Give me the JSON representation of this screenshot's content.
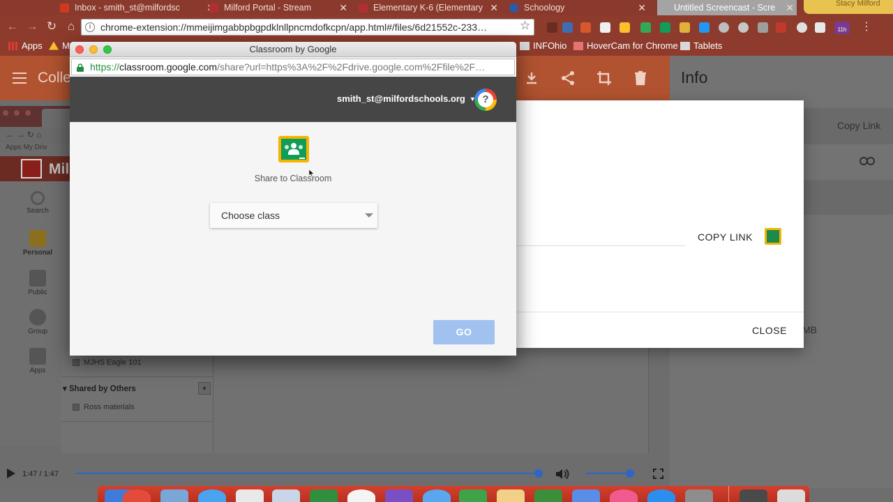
{
  "chrome": {
    "tabs": [
      {
        "label": "Inbox - smith_st@milfordsc",
        "color": "#d0391d"
      },
      {
        "label": "Milford Portal - Stream",
        "color": "#b03030"
      },
      {
        "label": "Elementary K-6 (Elementary",
        "color": "#b03030"
      },
      {
        "label": "Schoology",
        "color": "#2a5aa8"
      },
      {
        "label": "Untitled Screencast - Scre",
        "color": "#9a9a9a"
      }
    ],
    "profile": "Stacy Milford",
    "url": "chrome-extension://mmeijimgabbpbgpdklnllpncmdofkcpn/app.html#/files/6d21552c-233…",
    "bookmarks": [
      {
        "label": "Apps"
      },
      {
        "label": "M"
      },
      {
        "label": "INFOhio"
      },
      {
        "label": "HoverCam for Chrome"
      },
      {
        "label": "Tablets"
      }
    ],
    "extension_badge": "11h"
  },
  "app": {
    "title": "Colle",
    "info_title": "Info",
    "copy_link": "Copy Link",
    "size_suffix": "MB"
  },
  "inner": {
    "brand": "Mil",
    "bookmarks": "Apps   My Driv",
    "rail": [
      {
        "label": "Search",
        "icon": "search-icon"
      },
      {
        "label": "Personal",
        "icon": "personal-icon"
      },
      {
        "label": "Public",
        "icon": "public-icon"
      },
      {
        "label": "Group",
        "icon": "group-icon"
      },
      {
        "label": "Apps",
        "icon": "apps-icon"
      }
    ],
    "tree_item": "MJHS Eagle 101",
    "shared_header": "Shared by Others",
    "shared_item": "Ross materials"
  },
  "share_dialog": {
    "copy_link": "COPY LINK",
    "close": "CLOSE"
  },
  "popup": {
    "window_title": "Classroom by Google",
    "url_scheme": "https://",
    "url_host": "classroom.google.com",
    "url_rest": "/share?url=https%3A%2F%2Fdrive.google.com%2Ffile%2F…",
    "account": "smith_st@milfordschools.org",
    "help_label": "?",
    "share_label": "Share to Classroom",
    "class_select": "Choose class",
    "go": "GO"
  },
  "player": {
    "time": "1:47 / 1:47",
    "progress": 1.0,
    "volume": 0.9
  },
  "colors": {
    "accent": "#4285f4",
    "classroom_green": "#0f9d58",
    "classroom_yellow": "#f5b400",
    "go_disabled": "#a1c2f0"
  }
}
